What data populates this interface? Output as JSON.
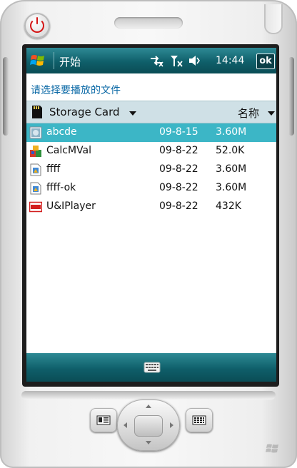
{
  "taskbar": {
    "start_label": "开始",
    "time": "14:44",
    "ok_label": "ok",
    "status_icons": [
      "connectivity-icon",
      "signal-icon",
      "volume-icon"
    ]
  },
  "prompt": "请选择要播放的文件",
  "location": {
    "folder": "Storage Card",
    "sort_label": "名称"
  },
  "files": [
    {
      "name": "abcde",
      "date": "09-8-15",
      "size": "3.60M",
      "icon": "video-file-icon",
      "selected": true
    },
    {
      "name": "CalcMVal",
      "date": "09-8-22",
      "size": "52.0K",
      "icon": "app-file-icon",
      "selected": false
    },
    {
      "name": "ffff",
      "date": "09-8-22",
      "size": "3.60M",
      "icon": "media-file-icon",
      "selected": false
    },
    {
      "name": "ffff-ok",
      "date": "09-8-22",
      "size": "3.60M",
      "icon": "media-file-icon",
      "selected": false
    },
    {
      "name": "U&IPlayer",
      "date": "09-8-22",
      "size": "432K",
      "icon": "player-app-icon",
      "selected": false
    }
  ],
  "colors": {
    "titlebar": "#0f5f6a",
    "selection": "#3cb6c6",
    "prompt_text": "#0b69a6",
    "header_bar": "#cfe0e6"
  }
}
